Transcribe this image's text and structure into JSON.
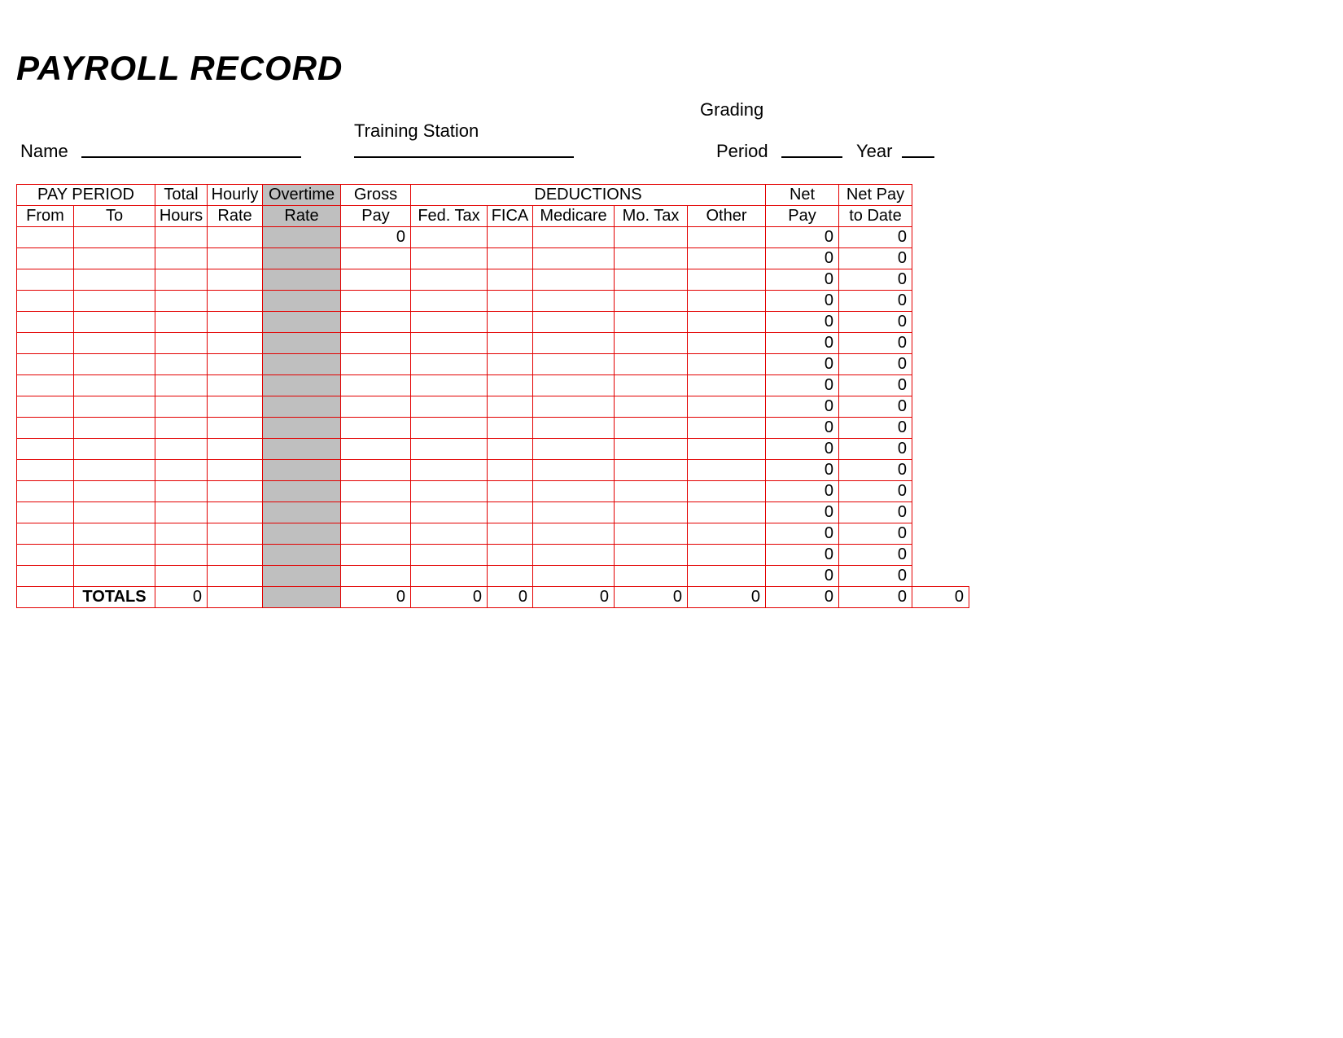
{
  "doc": {
    "title": "PAYROLL RECORD",
    "labels": {
      "name": "Name",
      "training_station": "Training Station",
      "grading": "Grading",
      "period": "Period",
      "year": "Year"
    }
  },
  "table": {
    "headers": {
      "pay_period": "PAY PERIOD",
      "from": "From",
      "to": "To",
      "total_hours_1": "Total",
      "total_hours_2": "Hours",
      "hourly_rate_1": "Hourly",
      "hourly_rate_2": "Rate",
      "overtime_rate_1": "Overtime",
      "overtime_rate_2": "Rate",
      "gross_pay_1": "Gross",
      "gross_pay_2": "Pay",
      "deductions": "DEDUCTIONS",
      "fed_tax": "Fed. Tax",
      "fica": "FICA",
      "medicare": "Medicare",
      "mo_tax": "Mo. Tax",
      "other": "Other",
      "net_pay_1": "Net",
      "net_pay_2": "Pay",
      "net_pay_to_date_1": "Net Pay",
      "net_pay_to_date_2": "to Date"
    },
    "rows": [
      {
        "from": "",
        "to": "",
        "total_hours": "",
        "hourly_rate": "",
        "overtime_rate": "",
        "gross_pay": "0",
        "fed_tax": "",
        "fica": "",
        "medicare": "",
        "mo_tax": "",
        "other": "",
        "net_pay": "0",
        "net_pay_to_date": "0"
      },
      {
        "from": "",
        "to": "",
        "total_hours": "",
        "hourly_rate": "",
        "overtime_rate": "",
        "gross_pay": "",
        "fed_tax": "",
        "fica": "",
        "medicare": "",
        "mo_tax": "",
        "other": "",
        "net_pay": "0",
        "net_pay_to_date": "0"
      },
      {
        "from": "",
        "to": "",
        "total_hours": "",
        "hourly_rate": "",
        "overtime_rate": "",
        "gross_pay": "",
        "fed_tax": "",
        "fica": "",
        "medicare": "",
        "mo_tax": "",
        "other": "",
        "net_pay": "0",
        "net_pay_to_date": "0"
      },
      {
        "from": "",
        "to": "",
        "total_hours": "",
        "hourly_rate": "",
        "overtime_rate": "",
        "gross_pay": "",
        "fed_tax": "",
        "fica": "",
        "medicare": "",
        "mo_tax": "",
        "other": "",
        "net_pay": "0",
        "net_pay_to_date": "0"
      },
      {
        "from": "",
        "to": "",
        "total_hours": "",
        "hourly_rate": "",
        "overtime_rate": "",
        "gross_pay": "",
        "fed_tax": "",
        "fica": "",
        "medicare": "",
        "mo_tax": "",
        "other": "",
        "net_pay": "0",
        "net_pay_to_date": "0"
      },
      {
        "from": "",
        "to": "",
        "total_hours": "",
        "hourly_rate": "",
        "overtime_rate": "",
        "gross_pay": "",
        "fed_tax": "",
        "fica": "",
        "medicare": "",
        "mo_tax": "",
        "other": "",
        "net_pay": "0",
        "net_pay_to_date": "0"
      },
      {
        "from": "",
        "to": "",
        "total_hours": "",
        "hourly_rate": "",
        "overtime_rate": "",
        "gross_pay": "",
        "fed_tax": "",
        "fica": "",
        "medicare": "",
        "mo_tax": "",
        "other": "",
        "net_pay": "0",
        "net_pay_to_date": "0"
      },
      {
        "from": "",
        "to": "",
        "total_hours": "",
        "hourly_rate": "",
        "overtime_rate": "",
        "gross_pay": "",
        "fed_tax": "",
        "fica": "",
        "medicare": "",
        "mo_tax": "",
        "other": "",
        "net_pay": "0",
        "net_pay_to_date": "0"
      },
      {
        "from": "",
        "to": "",
        "total_hours": "",
        "hourly_rate": "",
        "overtime_rate": "",
        "gross_pay": "",
        "fed_tax": "",
        "fica": "",
        "medicare": "",
        "mo_tax": "",
        "other": "",
        "net_pay": "0",
        "net_pay_to_date": "0"
      },
      {
        "from": "",
        "to": "",
        "total_hours": "",
        "hourly_rate": "",
        "overtime_rate": "",
        "gross_pay": "",
        "fed_tax": "",
        "fica": "",
        "medicare": "",
        "mo_tax": "",
        "other": "",
        "net_pay": "0",
        "net_pay_to_date": "0"
      },
      {
        "from": "",
        "to": "",
        "total_hours": "",
        "hourly_rate": "",
        "overtime_rate": "",
        "gross_pay": "",
        "fed_tax": "",
        "fica": "",
        "medicare": "",
        "mo_tax": "",
        "other": "",
        "net_pay": "0",
        "net_pay_to_date": "0"
      },
      {
        "from": "",
        "to": "",
        "total_hours": "",
        "hourly_rate": "",
        "overtime_rate": "",
        "gross_pay": "",
        "fed_tax": "",
        "fica": "",
        "medicare": "",
        "mo_tax": "",
        "other": "",
        "net_pay": "0",
        "net_pay_to_date": "0"
      },
      {
        "from": "",
        "to": "",
        "total_hours": "",
        "hourly_rate": "",
        "overtime_rate": "",
        "gross_pay": "",
        "fed_tax": "",
        "fica": "",
        "medicare": "",
        "mo_tax": "",
        "other": "",
        "net_pay": "0",
        "net_pay_to_date": "0"
      },
      {
        "from": "",
        "to": "",
        "total_hours": "",
        "hourly_rate": "",
        "overtime_rate": "",
        "gross_pay": "",
        "fed_tax": "",
        "fica": "",
        "medicare": "",
        "mo_tax": "",
        "other": "",
        "net_pay": "0",
        "net_pay_to_date": "0"
      },
      {
        "from": "",
        "to": "",
        "total_hours": "",
        "hourly_rate": "",
        "overtime_rate": "",
        "gross_pay": "",
        "fed_tax": "",
        "fica": "",
        "medicare": "",
        "mo_tax": "",
        "other": "",
        "net_pay": "0",
        "net_pay_to_date": "0"
      },
      {
        "from": "",
        "to": "",
        "total_hours": "",
        "hourly_rate": "",
        "overtime_rate": "",
        "gross_pay": "",
        "fed_tax": "",
        "fica": "",
        "medicare": "",
        "mo_tax": "",
        "other": "",
        "net_pay": "0",
        "net_pay_to_date": "0"
      },
      {
        "from": "",
        "to": "",
        "total_hours": "",
        "hourly_rate": "",
        "overtime_rate": "",
        "gross_pay": "",
        "fed_tax": "",
        "fica": "",
        "medicare": "",
        "mo_tax": "",
        "other": "",
        "net_pay": "0",
        "net_pay_to_date": "0"
      }
    ],
    "totals": {
      "label": "TOTALS",
      "total_hours": "0",
      "hourly_rate": "",
      "overtime_rate": "",
      "gross_pay": "0",
      "fed_tax": "0",
      "fica": "0",
      "medicare": "0",
      "mo_tax": "0",
      "other": "0",
      "net_pay": "0",
      "net_pay_to_date": "0",
      "extra": "0"
    }
  }
}
